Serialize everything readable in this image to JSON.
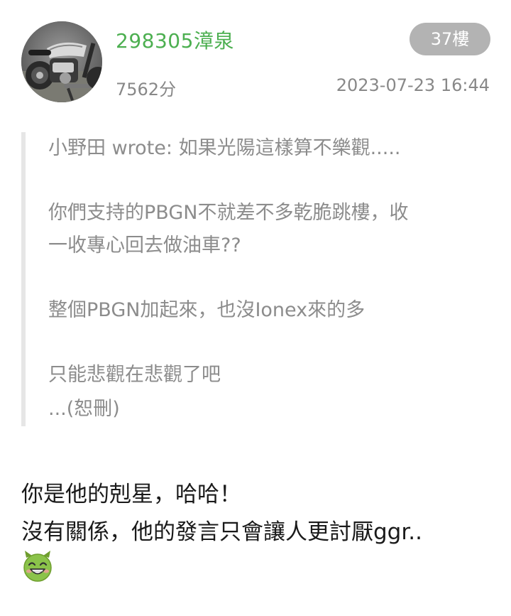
{
  "post": {
    "username": "298305漳泉",
    "floor_badge": "37樓",
    "score": "7562分",
    "timestamp": "2023-07-23 16:44",
    "avatar_icon": "motorcycle-avatar",
    "quote": {
      "lines": [
        "小野田 wrote: 如果光陽這樣算不樂觀.....",
        "你們支持的PBGN不就差不多乾脆跳樓，收",
        "一收專心回去做油車??",
        "整個PBGN加起來，也沒Ionex來的多",
        "只能悲觀在悲觀了吧",
        "...(恕刪)"
      ]
    },
    "reply": {
      "lines": [
        "你是他的剋星，哈哈！",
        "沒有關係，他的發言只會讓人更討厭ggr.."
      ],
      "emoji_icon": "grinning-devil-emoji"
    },
    "colors": {
      "username": "#4caf50",
      "badge_bg": "#b3b3b3",
      "meta_text": "#888888",
      "quote_text": "#8c8c8c",
      "quote_border": "#e6e6e6",
      "emoji_face": "#8bc34a"
    }
  }
}
